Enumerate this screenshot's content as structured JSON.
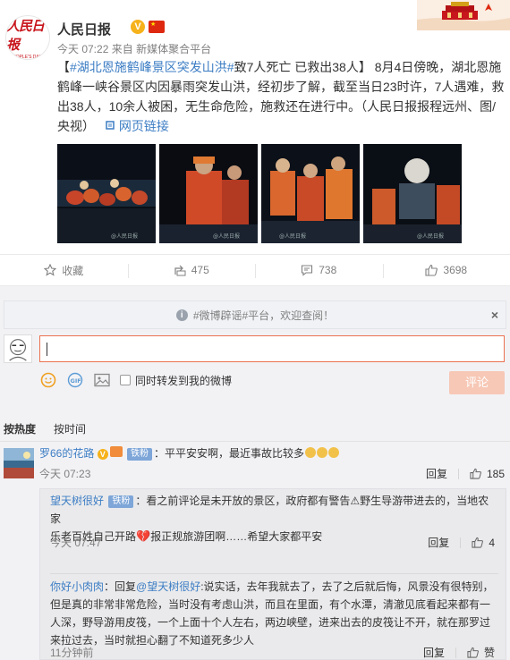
{
  "post": {
    "author": "人民日报",
    "avatar_text": "人民日报",
    "avatar_subtext": "PEOPLE'S DAILY",
    "time": "今天 07:22",
    "source_prefix": "来自",
    "source": "新媒体聚合平台",
    "topic": "#湖北恩施鹤峰景区突发山洪#",
    "headline": "致7人死亡 已救出38人】",
    "body": "8月4日傍晚，湖北恩施鹤峰一峡谷景区内因暴雨突发山洪，经初步了解，截至当日23时许，7人遇难，救出38人，10余人被困，无生命危险，施救还在进行中。（人民日报报程远州、图/央视）",
    "link_label": "网页链接",
    "images": [
      "rescue-photo-1",
      "rescue-photo-2",
      "rescue-photo-3",
      "rescue-photo-4"
    ],
    "image_watermark": "@人民日报"
  },
  "actions": {
    "favorite": "收藏",
    "repost": "475",
    "comment": "738",
    "like": "3698"
  },
  "comment_area": {
    "notice": "#微博辟谣#平台，欢迎查阅！",
    "input_value": "",
    "forward_label": "同时转发到我的微博",
    "submit_label": "评论",
    "sort_hot": "按热度",
    "sort_time": "按时间"
  },
  "comments": [
    {
      "user": "罗66的花路",
      "fan_badge": "铁粉",
      "text": "：平平安安啊，最近事故比较多",
      "time": "今天 07:23",
      "reply_label": "回复",
      "likes": "185"
    }
  ],
  "replies": [
    {
      "user": "望天树很好",
      "fan_badge": "铁粉",
      "text_1": "：看之前评论是未开放的景区，政府都有警告⚠野生导游带进去的，当地农家",
      "text_2a": "乐老百姓自己开路",
      "text_2b": "报正规旅游团啊……希望大家都平安",
      "time": "今天 07:47",
      "reply_label": "回复",
      "likes": "4"
    },
    {
      "user": "你好小肉肉",
      "reply_prefix": "：回复",
      "mention": "@望天树很好",
      "text_1": ":说实话，去年我就去了，去了之后就后悔，风景没有很特别，",
      "text_2": "但是真的非常非常危险，当时没有考虑山洪，而且在里面，有个水潭，清澈见底看起来都有一",
      "text_3": "人深，野导游用皮筏，一个上面十个人左右，两边峡壁，进来出去的皮筏让不开，就在那罗过",
      "text_4": "来拉过去，当时就担心翻了不知道死多少人",
      "time": "11分钟前",
      "reply_label": "回复",
      "likes": "赞"
    }
  ]
}
